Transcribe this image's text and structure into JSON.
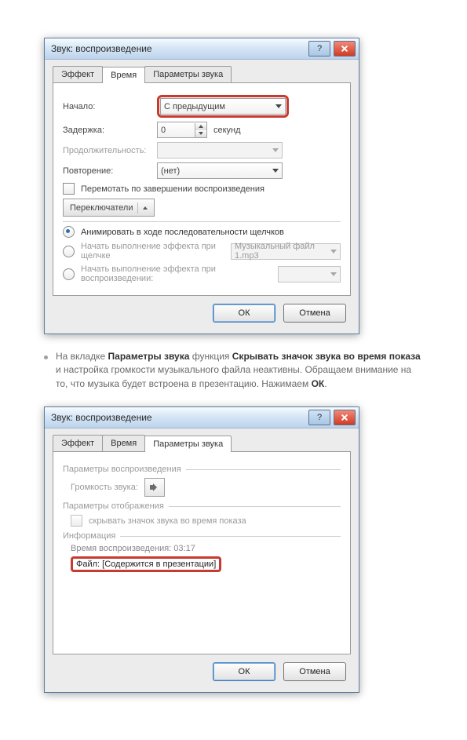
{
  "dlg1": {
    "title": "Звук: воспроизведение",
    "tabs": {
      "t1": "Эффект",
      "t2": "Время",
      "t3": "Параметры звука"
    },
    "time": {
      "start_label": "Начало:",
      "start_value": "С предыдущим",
      "delay_label": "Задержка:",
      "delay_value": "0",
      "delay_unit": "секунд",
      "duration_label": "Продолжительность:",
      "repeat_label": "Повторение:",
      "repeat_value": "(нет)",
      "rewind_label": "Перемотать по завершении воспроизведения",
      "triggers_btn": "Переключатели",
      "opt1": "Анимировать в ходе последовательности щелчков",
      "opt2": "Начать выполнение эффекта при щелчке",
      "opt2_value": "Музыкальный файл 1.mp3",
      "opt3": "Начать выполнение эффекта при воспроизведении:"
    },
    "ok": "ОК",
    "cancel": "Отмена"
  },
  "para": {
    "p1a": "На вкладке ",
    "p1b": "Параметры звука",
    "p1c": " функция ",
    "p1d": "Скрывать значок звука во время показа",
    "p1e": " и настройка громкости музыкального файла неактивны. Обращаем внимание на то, что музыка будет встроена в презентацию. Нажимаем ",
    "p1f": "ОК",
    "p1g": "."
  },
  "dlg2": {
    "title": "Звук: воспроизведение",
    "tabs": {
      "t1": "Эффект",
      "t2": "Время",
      "t3": "Параметры звука"
    },
    "params": {
      "group1": "Параметры воспроизведения",
      "volume_label": "Громкость звука:",
      "group2": "Параметры отображения",
      "hide_label": "скрывать значок звука во время показа",
      "group3": "Информация",
      "playtime_label": "Время воспроизведения: ",
      "playtime_value": "03:17",
      "file_label": "Файл: ",
      "file_value": "[Содержится в презентации]"
    },
    "ok": "ОК",
    "cancel": "Отмена"
  }
}
